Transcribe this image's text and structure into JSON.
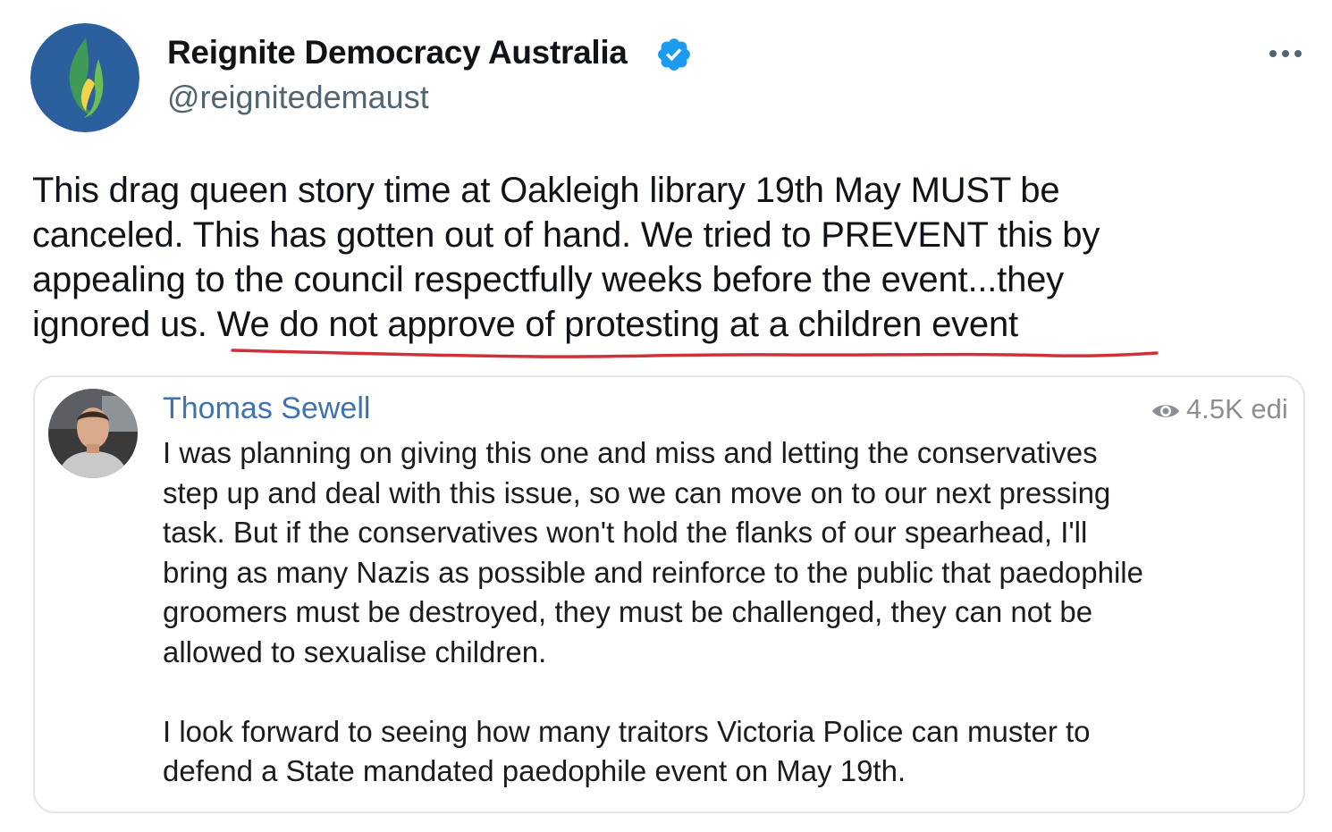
{
  "author": {
    "display_name": "Reignite Democracy Australia",
    "handle": "@reignitedemaust",
    "verified": true,
    "avatar_icon": "flame-logo-icon"
  },
  "tweet": {
    "lines": [
      "This drag queen story time at Oakleigh library 19th May MUST be",
      "canceled. This has gotten out of hand. We tried to PREVENT this by",
      "appealing to the council respectfully weeks before the event...they"
    ],
    "last_line_prefix": "ignored us. ",
    "last_line_underlined": "We do not approve of protesting at a children event",
    "underline_color": "#d0303a"
  },
  "quote": {
    "name": "Thomas Sewell",
    "views": "4.5K edi",
    "paragraph1": [
      "I was planning on giving this one and miss and letting the conservatives",
      "step up and deal with this issue, so we can move on to our next pressing",
      "task. But if the conservatives won't hold the flanks of our spearhead, I'll",
      "bring as many Nazis as possible and reinforce to the public that paedophile",
      "groomers must be destroyed, they must be challenged, they can not be",
      "allowed to sexualise children."
    ],
    "paragraph2": [
      "I look forward to seeing how many traitors Victoria Police can muster to",
      "defend a State mandated paedophile event on May 19th."
    ]
  },
  "colors": {
    "verified_badge": "#1d9bf0",
    "quote_name": "#3f73b0",
    "handle": "#536471"
  }
}
